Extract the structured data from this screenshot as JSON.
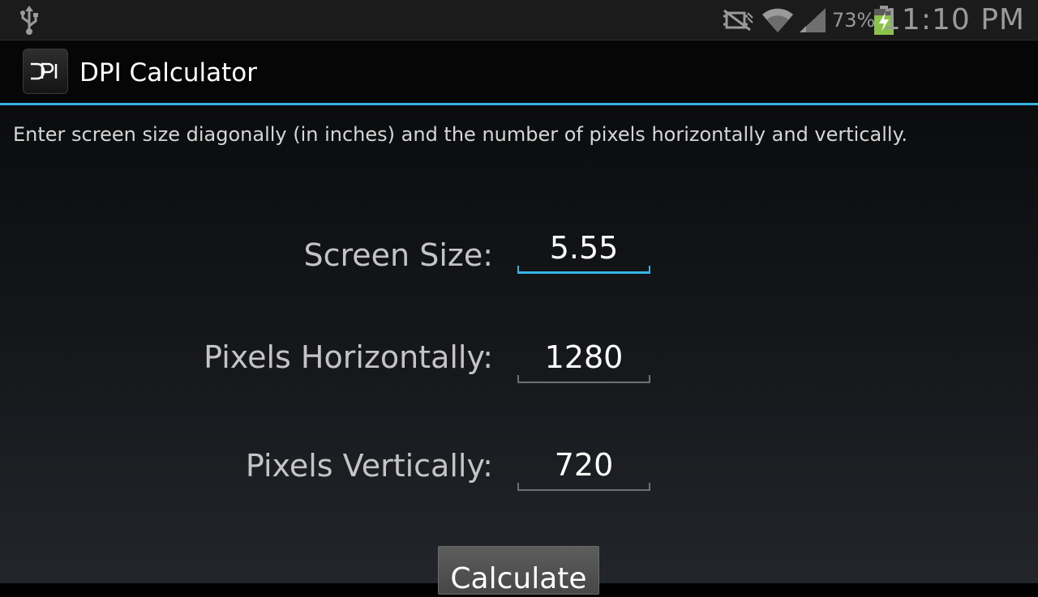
{
  "status_bar": {
    "icons": [
      "usb-icon",
      "mute-icon",
      "wifi-icon",
      "signal-icon",
      "battery-charging-icon"
    ],
    "battery_percent": "73%",
    "time": "11:10 PM",
    "colors": {
      "battery_fill": "#8bc34a"
    }
  },
  "action_bar": {
    "app_icon_text": "DPI",
    "title": "DPI Calculator",
    "accent_color": "#33b5e5"
  },
  "main": {
    "instructions": "Enter screen size diagonally (in inches) and the number of pixels horizontally and vertically.",
    "fields": {
      "screen_size": {
        "label": "Screen Size:",
        "value": "5.55"
      },
      "pixels_horizontal": {
        "label": "Pixels Horizontally:",
        "value": "1280"
      },
      "pixels_vertical": {
        "label": "Pixels Vertically:",
        "value": "720"
      }
    },
    "calculate_label": "Calculate"
  }
}
